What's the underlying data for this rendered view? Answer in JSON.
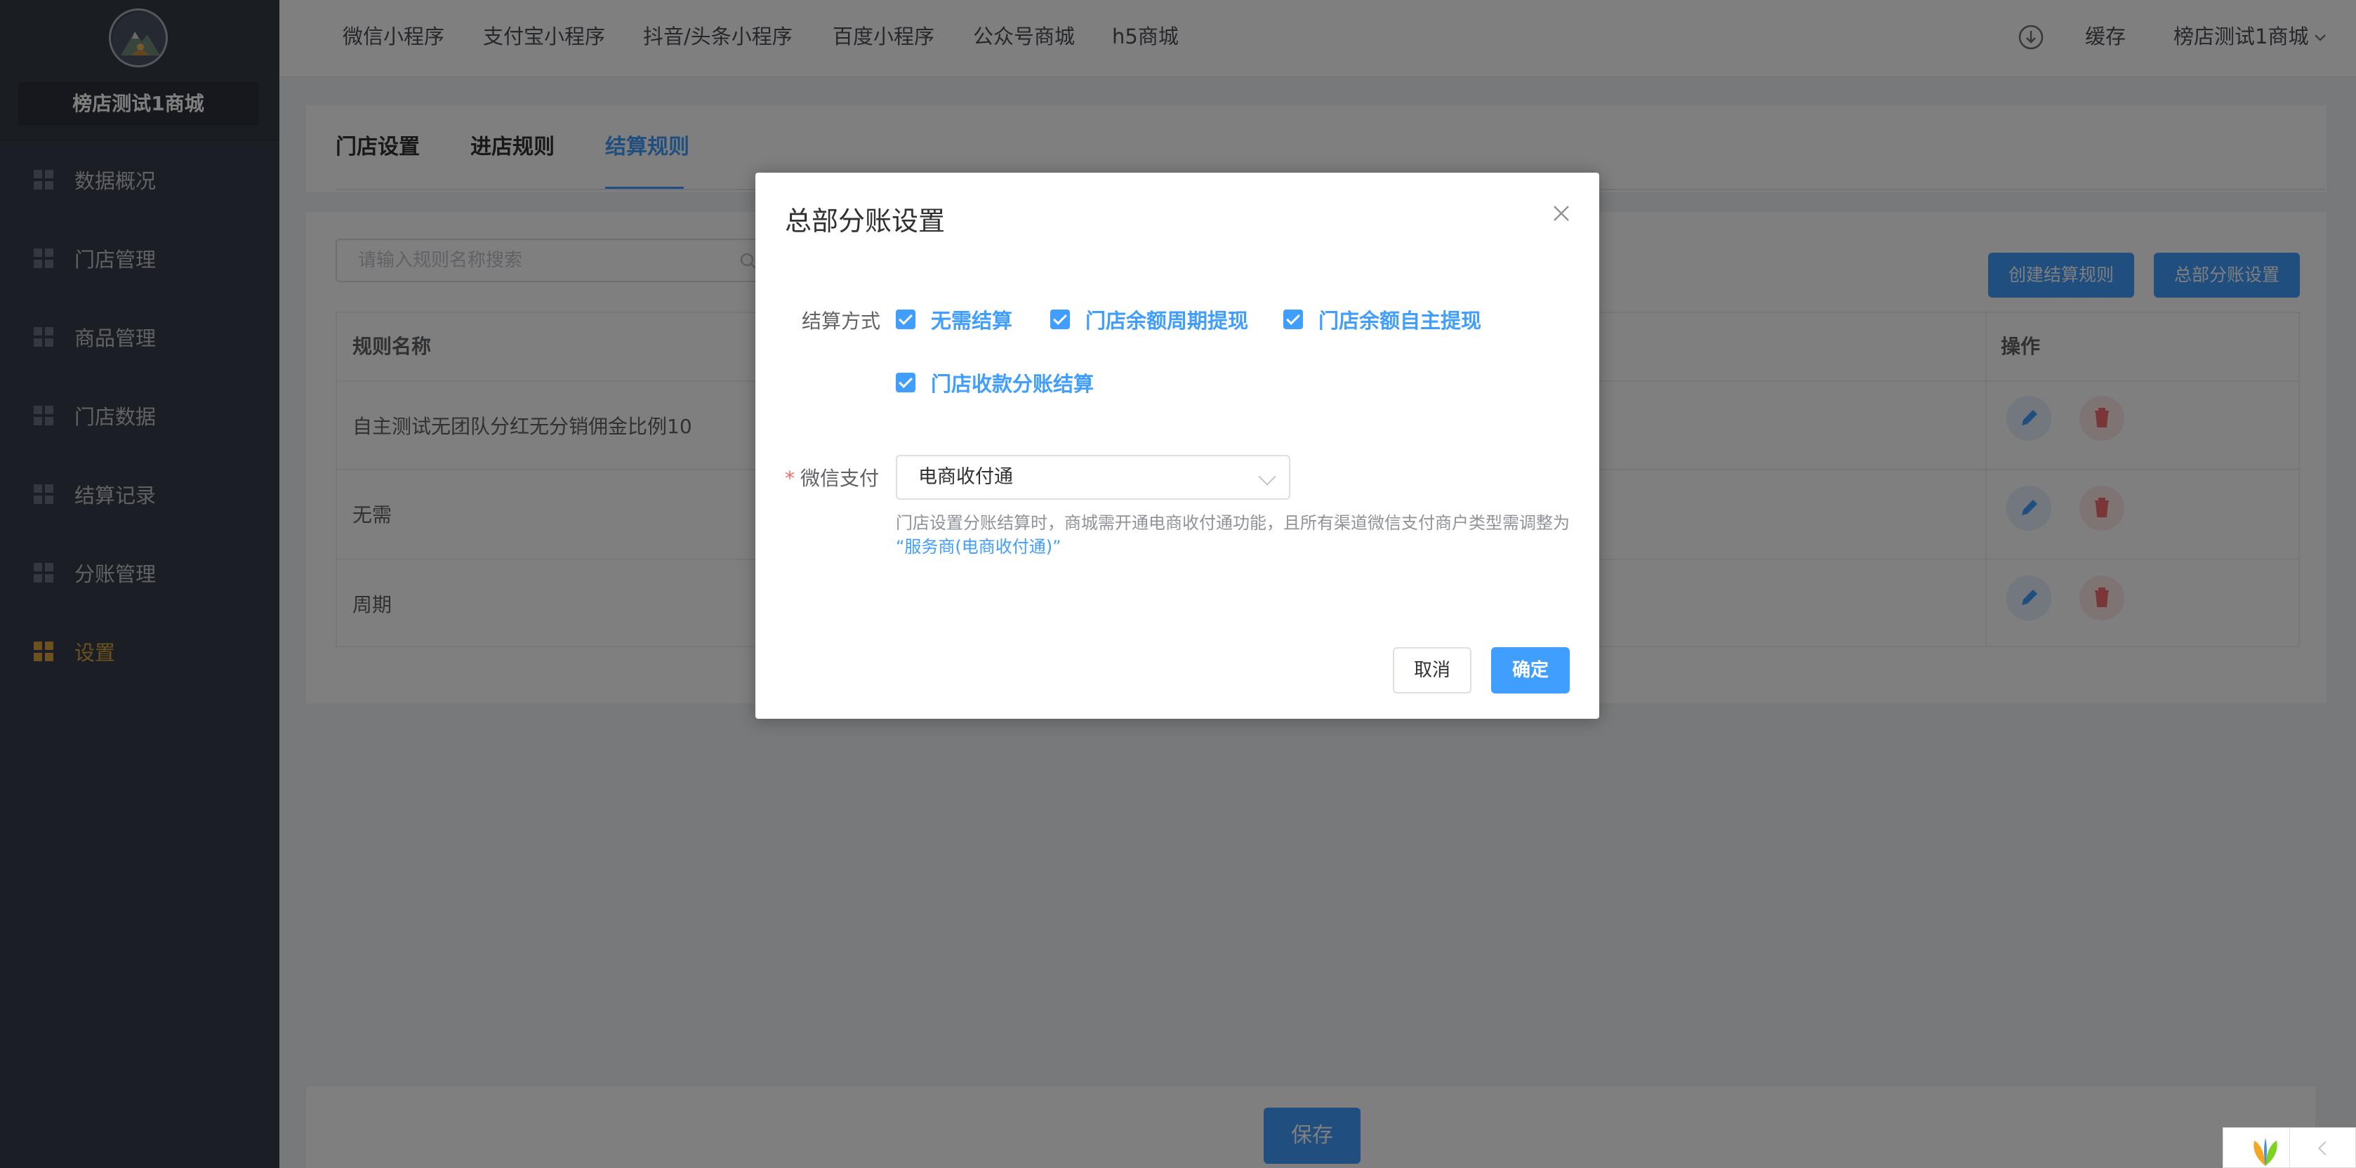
{
  "sidebar": {
    "shop_name": "榜店测试1商城",
    "items": [
      {
        "label": "数据概况",
        "icon": "grid-icon",
        "active": false
      },
      {
        "label": "门店管理",
        "icon": "grid-icon",
        "active": false
      },
      {
        "label": "商品管理",
        "icon": "grid-icon",
        "active": false
      },
      {
        "label": "门店数据",
        "icon": "grid-icon",
        "active": false
      },
      {
        "label": "结算记录",
        "icon": "grid-icon",
        "active": false
      },
      {
        "label": "分账管理",
        "icon": "grid-icon",
        "active": false
      },
      {
        "label": "设置",
        "icon": "grid-icon",
        "active": true
      }
    ]
  },
  "topbar": {
    "tabs": [
      "微信小程序",
      "支付宝小程序",
      "抖音/头条小程序",
      "百度小程序",
      "公众号商城",
      "h5商城"
    ],
    "cache_label": "缓存",
    "account_label": "榜店测试1商城",
    "download_icon": "download-icon"
  },
  "content": {
    "tabs": [
      {
        "label": "门店设置",
        "active": false
      },
      {
        "label": "进店规则",
        "active": false
      },
      {
        "label": "结算规则",
        "active": true
      }
    ],
    "search_placeholder": "请输入规则名称搜索",
    "create_button": "创建结算规则",
    "hq_button": "总部分账设置",
    "table": {
      "headers": [
        "规则名称",
        "操作"
      ],
      "rows": [
        "自主测试无团队分红无分销佣金比例10",
        "无需",
        "周期"
      ]
    },
    "save_button": "保存"
  },
  "dialog": {
    "title": "总部分账设置",
    "settle_label": "结算方式",
    "options": [
      "无需结算",
      "门店余额周期提现",
      "门店余额自主提现",
      "门店收款分账结算"
    ],
    "wechat_label": "微信支付",
    "required_mark": "*",
    "wechat_value": "电商收付通",
    "hint_text": "门店设置分账结算时，商城需开通电商收付通功能，且所有渠道微信支付商户类型需调整为",
    "hint_link": "“服务商(电商收付通)”",
    "cancel_button": "取消",
    "confirm_button": "确定"
  },
  "colors": {
    "primary": "#409eff",
    "sidebar_bg": "#373d49",
    "active_menu": "#d5a23a",
    "danger": "#f56c6c"
  }
}
